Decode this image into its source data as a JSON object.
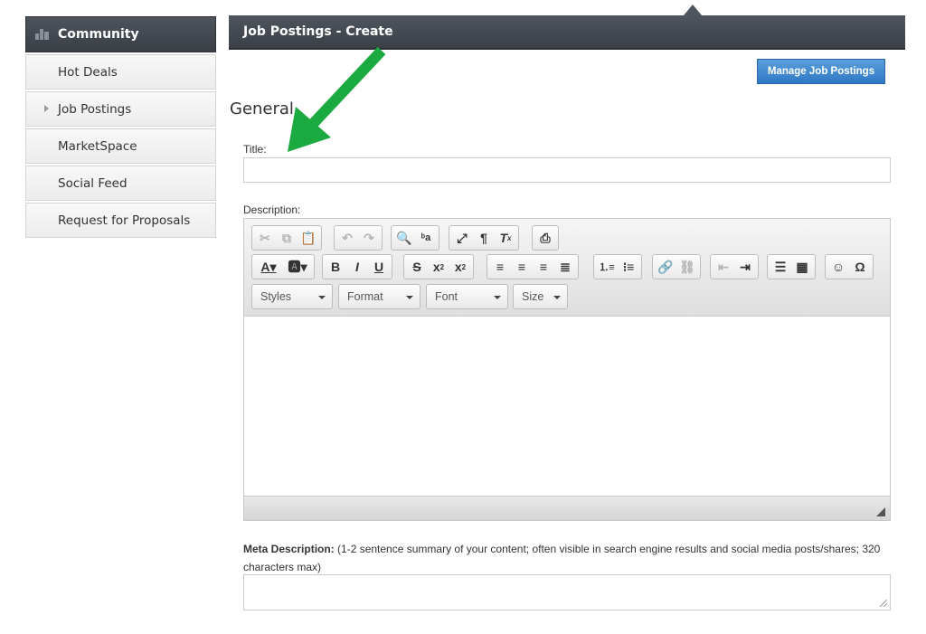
{
  "sidebar": {
    "header": "Community",
    "items": [
      {
        "label": "Hot Deals"
      },
      {
        "label": "Job Postings"
      },
      {
        "label": "MarketSpace"
      },
      {
        "label": "Social Feed"
      },
      {
        "label": "Request for Proposals"
      }
    ]
  },
  "header": {
    "title": "Job Postings - Create"
  },
  "actions": {
    "manage_label": "Manage Job Postings"
  },
  "form": {
    "section_title": "General",
    "title_label": "Title:",
    "title_value": "",
    "description_label": "Description:",
    "meta_label": "Meta Description:",
    "meta_hint": " (1-2 sentence summary of your content; often visible in search engine results and social media posts/shares; 320 characters max)",
    "meta_value": ""
  },
  "editor": {
    "combos": {
      "styles": "Styles",
      "format": "Format",
      "font": "Font",
      "size": "Size"
    }
  },
  "colors": {
    "accent_button": "#2f78c4",
    "header_bg": "#3b4047",
    "arrow": "#1aaa3f"
  }
}
